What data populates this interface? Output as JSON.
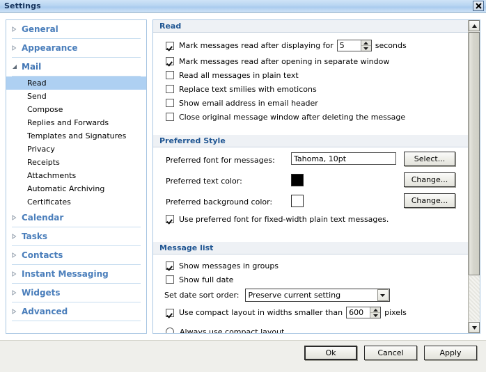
{
  "window": {
    "title": "Settings",
    "close_icon": "close-icon"
  },
  "sidebar": {
    "groups": [
      {
        "label": "General",
        "expanded": false,
        "icon": "triangle-right-icon",
        "children": []
      },
      {
        "label": "Appearance",
        "expanded": false,
        "icon": "triangle-right-icon",
        "children": []
      },
      {
        "label": "Mail",
        "expanded": true,
        "icon": "triangle-down-icon",
        "children": [
          {
            "label": "Read",
            "selected": true
          },
          {
            "label": "Send",
            "selected": false
          },
          {
            "label": "Compose",
            "selected": false
          },
          {
            "label": "Replies and Forwards",
            "selected": false
          },
          {
            "label": "Templates and Signatures",
            "selected": false
          },
          {
            "label": "Privacy",
            "selected": false
          },
          {
            "label": "Receipts",
            "selected": false
          },
          {
            "label": "Attachments",
            "selected": false
          },
          {
            "label": "Automatic Archiving",
            "selected": false
          },
          {
            "label": "Certificates",
            "selected": false
          }
        ]
      },
      {
        "label": "Calendar",
        "expanded": false,
        "icon": "triangle-right-icon",
        "children": []
      },
      {
        "label": "Tasks",
        "expanded": false,
        "icon": "triangle-right-icon",
        "children": []
      },
      {
        "label": "Contacts",
        "expanded": false,
        "icon": "triangle-right-icon",
        "children": []
      },
      {
        "label": "Instant Messaging",
        "expanded": false,
        "icon": "triangle-right-icon",
        "children": []
      },
      {
        "label": "Widgets",
        "expanded": false,
        "icon": "triangle-right-icon",
        "children": []
      },
      {
        "label": "Advanced",
        "expanded": false,
        "icon": "triangle-right-icon",
        "children": []
      }
    ]
  },
  "panel": {
    "read": {
      "header": "Read",
      "opt_mark_after_display_prefix": "Mark messages read after displaying for",
      "opt_mark_after_display_checked": true,
      "display_seconds_value": "5",
      "display_seconds_suffix": "seconds",
      "opt_mark_after_open": "Mark messages read after opening in separate window",
      "opt_mark_after_open_checked": true,
      "opt_plain_text": "Read all messages in plain text",
      "opt_plain_text_checked": false,
      "opt_smilies": "Replace text smilies with emoticons",
      "opt_smilies_checked": false,
      "opt_show_email_address": "Show email address in email header",
      "opt_show_email_address_checked": false,
      "opt_close_original": "Close original message window after deleting the message",
      "opt_close_original_checked": false
    },
    "preferred_style": {
      "header": "Preferred Style",
      "font_label": "Preferred font for messages:",
      "font_value": "Tahoma, 10pt",
      "font_button": "Select...",
      "text_color_label": "Preferred text color:",
      "text_color_value": "#000000",
      "text_color_button": "Change...",
      "bg_color_label": "Preferred background color:",
      "bg_color_value": "#ffffff",
      "bg_color_button": "Change...",
      "opt_fixed_width": "Use preferred font for fixed-width plain text messages.",
      "opt_fixed_width_checked": true
    },
    "message_list": {
      "header": "Message list",
      "opt_groups": "Show messages in groups",
      "opt_groups_checked": true,
      "opt_full_date": "Show full date",
      "opt_full_date_checked": false,
      "sort_label": "Set date sort order:",
      "sort_value": "Preserve current setting",
      "opt_compact_prefix": "Use compact layout in widths smaller than",
      "opt_compact_checked": true,
      "compact_width_value": "600",
      "compact_width_suffix": "pixels",
      "opt_always_compact": "Always use compact layout",
      "opt_always_compact_checked": false
    },
    "scrollbar": {
      "up_icon": "scroll-up-icon",
      "down_icon": "scroll-down-icon"
    }
  },
  "footer": {
    "ok": "Ok",
    "cancel": "Cancel",
    "apply": "Apply"
  }
}
